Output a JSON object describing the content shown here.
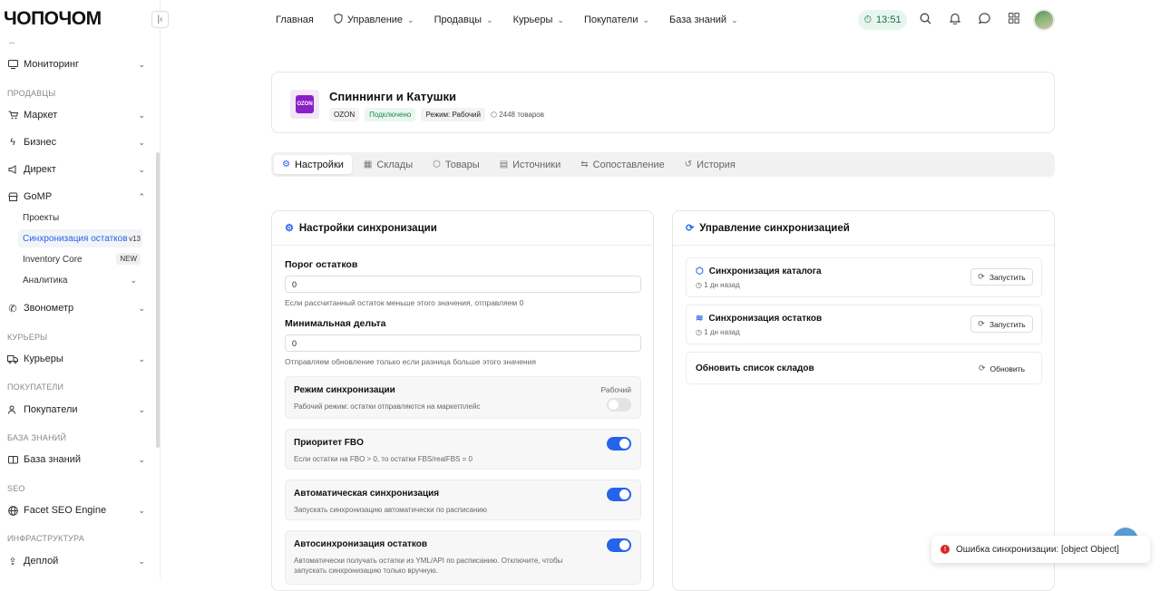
{
  "app": {
    "logo": "ЧОПОЧОМ",
    "time": "13:51"
  },
  "sidebar": {
    "dash": "--",
    "monitoring": "Мониторинг",
    "sec_sellers": "ПРОДАВЦЫ",
    "market": "Маркет",
    "business": "Бизнес",
    "direct": "Директ",
    "gomp": "GoMP",
    "gomp_items": {
      "projects": "Проекты",
      "sync": "Синхронизация остатков",
      "sync_badge": "v13",
      "inventory": "Inventory Core",
      "inventory_badge": "NEW",
      "analytics": "Аналитика"
    },
    "zvonometr": "Звонометр",
    "sec_couriers": "КУРЬЕРЫ",
    "couriers": "Курьеры",
    "sec_buyers": "ПОКУПАТЕЛИ",
    "buyers": "Покупатели",
    "sec_kb": "БАЗА ЗНАНИЙ",
    "kb": "База знаний",
    "sec_seo": "SEO",
    "seo": "Facet SEO Engine",
    "sec_infra": "ИНФРАСТРУКТУРА",
    "deploy": "Деплой"
  },
  "topnav": {
    "home": "Главная",
    "manage": "Управление",
    "sellers": "Продавцы",
    "couriers": "Курьеры",
    "buyers": "Покупатели",
    "kb": "База знаний"
  },
  "shop": {
    "logo_text": "OZON",
    "title": "Спиннинги и Катушки",
    "tag_platform": "OZON",
    "tag_status": "Подключено",
    "tag_mode": "Режим: Рабочий",
    "count": "2448 товаров"
  },
  "tabs": [
    "Настройки",
    "Склады",
    "Товары",
    "Источники",
    "Сопоставление",
    "История"
  ],
  "settings": {
    "title": "Настройки синхронизации",
    "threshold_label": "Порог остатков",
    "threshold_value": "0",
    "threshold_help": "Если рассчитанный остаток меньше этого значения, отправляем 0",
    "delta_label": "Минимальная дельта",
    "delta_value": "0",
    "delta_help": "Отправляем обновление только если разница больше этого значения",
    "mode_title": "Режим синхронизации",
    "mode_desc": "Рабочий режим: остатки отправляются на маркетплейс",
    "mode_state": "Рабочий",
    "fbo_title": "Приоритет FBO",
    "fbo_desc": "Если остатки на FBO > 0, то остатки FBS/realFBS = 0",
    "auto_title": "Автоматическая синхронизация",
    "auto_desc": "Запускать синхронизацию автоматически по расписанию",
    "autostock_title": "Автосинхронизация остатков",
    "autostock_desc": "Автоматически получать остатки из YML/API по расписанию. Отключите, чтобы запускать синхронизацию только вручную."
  },
  "mgmt": {
    "title": "Управление синхронизацией",
    "catalog_title": "Синхронизация каталога",
    "catalog_time": "1 дн назад",
    "stock_title": "Синхронизация остатков",
    "stock_time": "1 дн назад",
    "run_label": "Запустить",
    "warehouses_title": "Обновить список складов",
    "refresh_label": "Обновить"
  },
  "toast": {
    "text": "Ошибка синхронизации: [object Object]"
  },
  "colors": {
    "accent": "#2563eb",
    "ozon": "#8b1fc8",
    "error": "#dc2626",
    "success": "#1f8a4c"
  }
}
